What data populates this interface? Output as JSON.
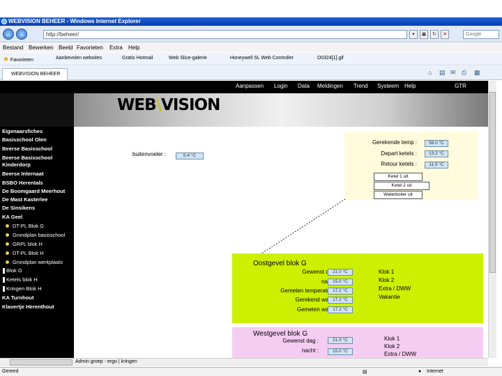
{
  "window": {
    "title": "WEBVISION BEHEER - Windows Internet Explorer"
  },
  "address": {
    "url": "http://beheer/",
    "search_placeholder": "Google"
  },
  "menu": [
    "Bestand",
    "Bewerken",
    "Beeld",
    "Favorieten",
    "Extra",
    "Help"
  ],
  "favorites": {
    "label": "Favorieten",
    "items": [
      "Aanbevolen websites",
      "Gratis Hotmail",
      "Web Slice-galerie",
      "Honeywell SL Web Controller",
      "D0324[1].gif"
    ]
  },
  "tab": {
    "label": "WEBVISION BEHEER"
  },
  "page": {
    "logo": {
      "prefix": "WEB",
      "mark": "\\",
      "suffix": "VISION"
    },
    "topnav": [
      "Aanpassen",
      "Login",
      "Data",
      "Meldingen",
      "Trend",
      "Systeem",
      "Help",
      "GTR"
    ],
    "sidebar": [
      {
        "label": "Eigenaarsfiches",
        "type": "main"
      },
      {
        "label": "Basisschool Olen",
        "type": "main"
      },
      {
        "label": "Beerse Basisschool",
        "type": "main"
      },
      {
        "label": "Beerse Basisschool",
        "type": "main"
      },
      {
        "label": "Kinderdorp",
        "type": "main"
      },
      {
        "label": "Beerse Internaat",
        "type": "main"
      },
      {
        "label": "BSBO Herentals",
        "type": "main"
      },
      {
        "label": "De Boomgaard Meerhout",
        "type": "main"
      },
      {
        "label": "De Mast Kasterlee",
        "type": "main"
      },
      {
        "label": "De Sinsikens",
        "type": "main"
      },
      {
        "label": "KA Geel",
        "type": "main"
      },
      {
        "label": "DT-PL Blok G",
        "type": "sub"
      },
      {
        "label": "Grondplan basisschool",
        "type": "sub"
      },
      {
        "label": "GRPL blok H",
        "type": "sub"
      },
      {
        "label": "DT-PL Blok H",
        "type": "sub"
      },
      {
        "label": "Grondplan werkplaats",
        "type": "sub"
      },
      {
        "label": "Blok G",
        "type": "white"
      },
      {
        "label": "Ketels blok H",
        "type": "white"
      },
      {
        "label": "Kringen Blok H",
        "type": "white"
      },
      {
        "label": "KA Turnhout",
        "type": "main"
      },
      {
        "label": "Klavertje Herenthout",
        "type": "main"
      }
    ],
    "buitenvoeler": {
      "label": "buitenvoeler :",
      "value": "5.4 °C"
    },
    "boiler_panel": {
      "rows": [
        {
          "label": "Gerekende temp :",
          "value": "58.0 °C"
        },
        {
          "label": "Depart ketels :",
          "value": "13.2 °C"
        },
        {
          "label": "Retour ketels :",
          "value": "11.5 °C"
        }
      ],
      "buttons": [
        "Ketel 1 uit",
        "Ketel 2 uit",
        "Waterboiler uit"
      ]
    },
    "green_panel": {
      "title": "Oostgevel blok G",
      "rows": [
        {
          "label": "Gewenst dag :",
          "value": "21.0 °C"
        },
        {
          "label": "nacht :",
          "value": "15.0 °C"
        },
        {
          "label": "Gemeten temperatuur :",
          "value": "17.2 °C"
        },
        {
          "label": "Gerekend water :",
          "value": "17.2 °C"
        },
        {
          "label": "Gemeten water :",
          "value": "17.2 °C"
        }
      ],
      "side": [
        "Klok 1",
        "Klok 2",
        "Extra / DWW",
        "Vakantie"
      ]
    },
    "pink_panel": {
      "title": "Westgevel blok G",
      "rows": [
        {
          "label": "Gewenst dag :",
          "value": "21.0 °C"
        },
        {
          "label": "nacht :",
          "value": "15.0 °C"
        }
      ],
      "side": [
        "Klok 1",
        "Klok 2",
        "Extra / DWW"
      ]
    },
    "hscroll_label": "Admin groep - ergo | kringen"
  },
  "status": {
    "left": "Gereed",
    "zone": "Internet"
  },
  "colors": {
    "green_panel": "#ccf000",
    "pink_panel": "#f5ccf2",
    "yellow_panel": "#fffbdc",
    "nav_bg": "#000000"
  }
}
